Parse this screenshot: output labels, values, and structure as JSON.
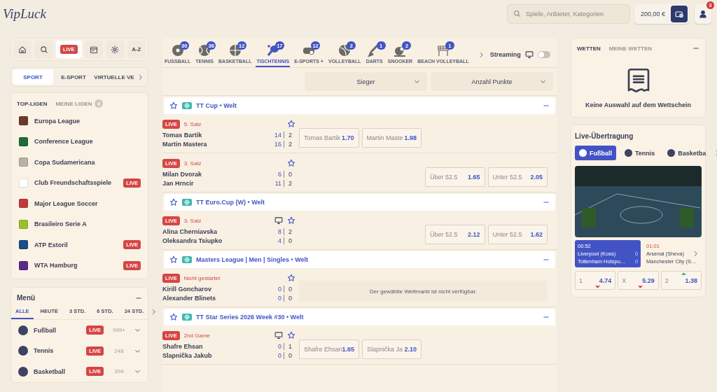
{
  "header": {
    "logo": "VipLuck",
    "search": {
      "placeholder": "Spiele, Anbieter, Kategorien"
    },
    "balance": "200,00 €",
    "notifications": "3"
  },
  "quick_nav": [
    {
      "kind": "icon",
      "selected": false
    },
    {
      "kind": "icon",
      "selected": false
    },
    {
      "kind": "live",
      "label": "LIVE",
      "selected": true
    },
    {
      "kind": "icon",
      "selected": false
    },
    {
      "kind": "icon",
      "selected": false
    },
    {
      "kind": "text",
      "label": "A-Z",
      "selected": false
    }
  ],
  "category_tabs": [
    {
      "label": "SPORT",
      "selected": true
    },
    {
      "label": "E-SPORT",
      "selected": false
    },
    {
      "label": "VIRTUELLE VE",
      "selected": false
    }
  ],
  "leagues": {
    "tabs": [
      {
        "label": "TOP-LIGEN",
        "selected": true
      },
      {
        "label": "MEINE LIGEN",
        "selected": false,
        "count": "0"
      }
    ],
    "items": [
      {
        "name": "Europa League",
        "live": false
      },
      {
        "name": "Conference League",
        "live": false
      },
      {
        "name": "Copa Sudamericana",
        "live": false
      },
      {
        "name": "Club Freundschaftsspiele",
        "live": true,
        "badge": "LIVE"
      },
      {
        "name": "Major League Soccer",
        "live": false
      },
      {
        "name": "Brasileiro Serie A",
        "live": false
      },
      {
        "name": "ATP Estoril",
        "live": true,
        "badge": "LIVE"
      },
      {
        "name": "WTA Hamburg",
        "live": true,
        "badge": "LIVE"
      }
    ]
  },
  "menu": {
    "title": "Menü",
    "tabs": [
      {
        "label": "ALLE",
        "selected": true
      },
      {
        "label": "HEUTE",
        "selected": false
      },
      {
        "label": "3 STD.",
        "selected": false
      },
      {
        "label": "6 STD.",
        "selected": false
      },
      {
        "label": "24 STD.",
        "selected": false
      }
    ],
    "sports": [
      {
        "name": "Fußball",
        "live": true,
        "badge": "LIVE",
        "count": "999+"
      },
      {
        "name": "Tennis",
        "live": true,
        "badge": "LIVE",
        "count": "248"
      },
      {
        "name": "Basketball",
        "live": true,
        "badge": "LIVE",
        "count": "394"
      }
    ]
  },
  "sport_tabs": [
    {
      "label": "FUSSBALL",
      "count": "30",
      "selected": false
    },
    {
      "label": "TENNIS",
      "count": "36",
      "selected": false
    },
    {
      "label": "BASKETBALL",
      "count": "12",
      "selected": false
    },
    {
      "label": "TISCHTENNIS",
      "count": "17",
      "selected": true
    },
    {
      "label": "E-SPORTS +",
      "count": "12",
      "selected": false
    },
    {
      "label": "VOLLEYBALL",
      "count": "2",
      "selected": false
    },
    {
      "label": "DARTS",
      "count": "1",
      "selected": false
    },
    {
      "label": "SNOOKER",
      "count": "2",
      "selected": false
    },
    {
      "label": "BEACH VOLLEYBALL",
      "count": "1",
      "selected": false
    }
  ],
  "streaming": {
    "label": "Streaming",
    "on": false
  },
  "markets": [
    "Sieger",
    "Anzahl Punkte"
  ],
  "groups": [
    {
      "title": "TT Cup • Welt",
      "matches": [
        {
          "live": true,
          "badge": "LIVE",
          "status": "5. Satz",
          "tv": false,
          "kind": "winner",
          "players": [
            {
              "name": "Tomas Bartik",
              "points": "14",
              "sets": "2"
            },
            {
              "name": "Martin Mastera",
              "points": "16",
              "sets": "2"
            }
          ],
          "odds": [
            {
              "label": "Tomas Bartik",
              "value": "1.70"
            },
            {
              "label": "Martin Maste",
              "value": "1.98"
            }
          ]
        },
        {
          "live": true,
          "badge": "LIVE",
          "status": "3. Satz",
          "tv": false,
          "kind": "total",
          "players": [
            {
              "name": "Milan Dvorak",
              "points": "6",
              "sets": "0"
            },
            {
              "name": "Jan Hrncir",
              "points": "11",
              "sets": "2"
            }
          ],
          "odds": [
            {
              "label": "Über 52.5",
              "value": "1.65"
            },
            {
              "label": "Unter 52.5",
              "value": "2.05"
            }
          ]
        }
      ]
    },
    {
      "title": "TT Euro.Cup (W) • Welt",
      "matches": [
        {
          "live": true,
          "badge": "LIVE",
          "status": "3. Satz",
          "tv": true,
          "kind": "total",
          "players": [
            {
              "name": "Alina Cherniavska",
              "points": "8",
              "sets": "2"
            },
            {
              "name": "Oleksandra Tsiupko",
              "points": "4",
              "sets": "0"
            }
          ],
          "odds": [
            {
              "label": "Über 52.5",
              "value": "2.12"
            },
            {
              "label": "Unter 52.5",
              "value": "1.62"
            }
          ]
        }
      ]
    },
    {
      "title": "Masters League | Men | Singles • Welt",
      "matches": [
        {
          "live": true,
          "badge": "LIVE",
          "status": "Nicht gestartet",
          "tv": false,
          "kind": "unavailable",
          "players": [
            {
              "name": "Kirill Goncharov",
              "points": "0",
              "sets": "0"
            },
            {
              "name": "Alexander Blinets",
              "points": "0",
              "sets": "0"
            }
          ],
          "message": "Der gewählte Wettmarkt ist nicht verfügbar."
        }
      ]
    },
    {
      "title": "TT Star Series 2026 Week #30 • Welt",
      "matches": [
        {
          "live": true,
          "badge": "LIVE",
          "status": "2nd Game",
          "tv": true,
          "kind": "winner",
          "players": [
            {
              "name": "Shafre Ehsan",
              "points": "0",
              "sets": "1"
            },
            {
              "name": "Slapnička Jakub",
              "points": "0",
              "sets": "0"
            }
          ],
          "odds": [
            {
              "label": "Shafre Ehsan",
              "value": "1.65"
            },
            {
              "label": "Slapnička Ja",
              "value": "2.10"
            }
          ]
        }
      ]
    }
  ],
  "bet_slip": {
    "tabs": [
      {
        "label": "WETTEN",
        "selected": true
      },
      {
        "label": "MEINE WETTEN",
        "selected": false
      }
    ],
    "empty_text": "Keine Auswahl auf dem Wettschein"
  },
  "live_stream": {
    "title": "Live-Übertragung",
    "tabs": [
      {
        "label": "Fußball",
        "selected": true
      },
      {
        "label": "Tennis",
        "selected": false
      },
      {
        "label": "Basketba",
        "selected": false
      }
    ],
    "games": [
      {
        "time": "00:52",
        "selected": true,
        "teams": [
          {
            "name": "Liverpool (Koss)",
            "score": "0"
          },
          {
            "name": "Tottenham Hotspu…",
            "score": "0"
          }
        ]
      },
      {
        "time": "01:01",
        "selected": false,
        "teams": [
          {
            "name": "Arsenal (Sheva)"
          },
          {
            "name": "Manchester City (S…"
          }
        ]
      }
    ],
    "odds": [
      {
        "label": "1",
        "value": "4.74",
        "rising": false
      },
      {
        "label": "X",
        "value": "5.29",
        "rising": false
      },
      {
        "label": "2",
        "value": "1.38",
        "rising": true
      }
    ]
  }
}
